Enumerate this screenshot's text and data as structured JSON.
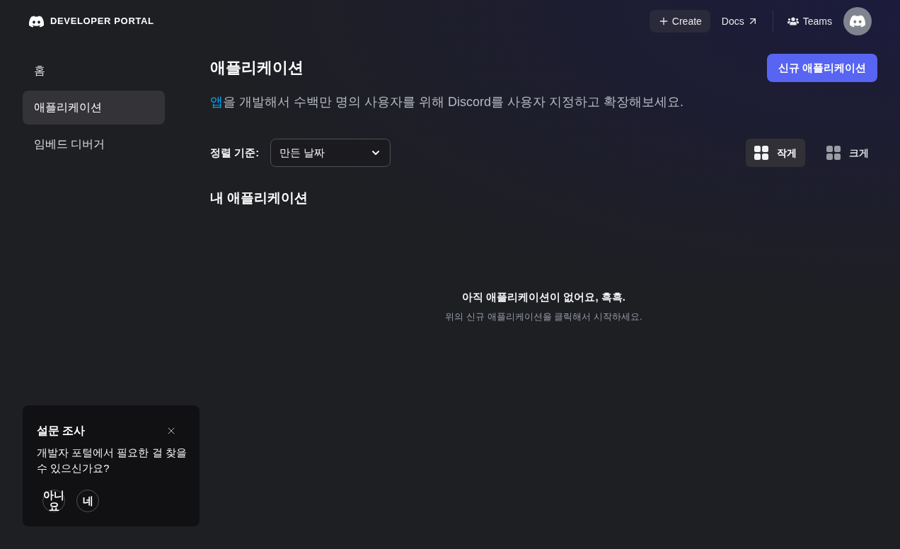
{
  "header": {
    "logo_text": "DEVELOPER PORTAL",
    "actions": [
      {
        "kind": "create",
        "label": "Create"
      },
      {
        "kind": "link",
        "label": "Docs"
      },
      {
        "kind": "teams",
        "label": "Teams"
      }
    ]
  },
  "sidebar": {
    "items": [
      {
        "label": "홈",
        "selected": false
      },
      {
        "label": "애플리케이션",
        "selected": true
      },
      {
        "label": "임베드 디버거",
        "selected": false
      }
    ]
  },
  "main": {
    "title": "애플리케이션",
    "new_button": "신규 애플리케이션",
    "subtitle": {
      "link": "앱",
      "text": "을 개발해서 수백만 명의 사용자를 위해 Discord를 사용자 지정하고 확장해보세요."
    },
    "sort": {
      "label": "정렬 기준:",
      "value": "만든 날짜"
    },
    "view_options": [
      {
        "label": "작게",
        "selected": true
      },
      {
        "label": "크게",
        "selected": false
      }
    ],
    "section_title": "내 애플리케이션",
    "empty_state": {
      "title": "아직 애플리케이션이 없어요, 흑흑.",
      "hint": "위의 신규 애플리케이션을 클릭해서 시작하세요."
    }
  },
  "survey": {
    "title": "설문 조사",
    "question": "개발자 포털에서 필요한 걸 찾을 수 있으신가요?",
    "answers": [
      "아니요",
      "네"
    ]
  }
}
